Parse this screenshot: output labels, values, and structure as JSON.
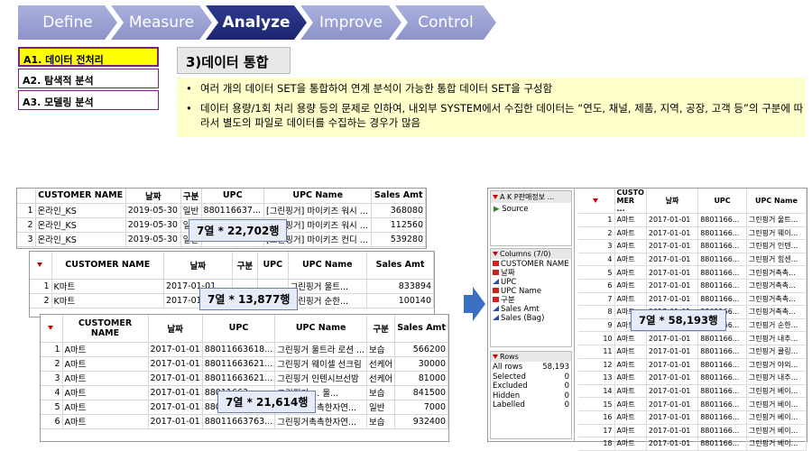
{
  "steps": [
    "Define",
    "Measure",
    "Analyze",
    "Improve",
    "Control"
  ],
  "side_items": [
    "A1. 데이터 전처리",
    "A2. 탐색적 분석",
    "A3. 모델링 분석"
  ],
  "section_title": "3)데이터 통합",
  "bullets": [
    "여러 개의 데이터 SET을 통합하여 연계 분석이 가능한 통합 데이터 SET을 구성함",
    "데이터 용량/1회 처리 용량 등의 문제로 인하여, 내외부 SYSTEM에서 수집한 데이터는 “연도, 채널, 제품, 지역, 공장, 고객 등”의 구분에 따라서 별도의 파일로 데이터를 수집하는 경우가 많음"
  ],
  "table1": {
    "headers": [
      "CUSTOMER NAME",
      "날짜",
      "구분",
      "UPC",
      "UPC Name",
      "Sales Amt"
    ],
    "rows": [
      [
        "1",
        "온라인_KS",
        "2019-05-30",
        "일반",
        "880116637...",
        "[그린핑거] 마이키즈 워시 ...",
        "368080"
      ],
      [
        "2",
        "온라인_KS",
        "2019-05-30",
        "일반",
        "",
        "[그린핑거] 마이키즈 워시 ...",
        "112560"
      ],
      [
        "3",
        "온라인_KS",
        "2019-05-30",
        "일반",
        "880116637...",
        "[그린핑거] 마이키즈 컨디 ...",
        "539280"
      ]
    ],
    "badge": "7열 * 22,702행"
  },
  "table2": {
    "headers": [
      "CUSTOMER NAME",
      "날짜",
      "구분",
      "UPC",
      "UPC Name",
      "Sales Amt"
    ],
    "rows": [
      [
        "1",
        "K마트",
        "2017-01-01",
        "",
        "",
        "그린핑거 울트...",
        "833894"
      ],
      [
        "2",
        "K마트",
        "2017-01-01",
        "",
        "",
        "그린핑거 순한...",
        "100140"
      ]
    ],
    "badge": "7열 * 13,877행"
  },
  "table3": {
    "headers": [
      "CUSTOMER NAME",
      "날짜",
      "UPC",
      "UPC Name",
      "구분",
      "Sales Amt"
    ],
    "rows": [
      [
        "1",
        "A마트",
        "2017-01-01",
        "88011663618...",
        "그린핑거 울트라 로션 ...",
        "보습",
        "566200"
      ],
      [
        "2",
        "A마트",
        "2017-01-01",
        "88011663621...",
        "그린핑거 웨이셀 선크림",
        "선케어",
        "30000"
      ],
      [
        "3",
        "A마트",
        "2017-01-01",
        "88011663621...",
        "그린핑거 인텐시브선밤",
        "선케어",
        "81000"
      ],
      [
        "4",
        "A마트",
        "2017-01-01",
        "88011663...",
        "그린핑거 ... 울...",
        "보습",
        "841500"
      ],
      [
        "5",
        "A마트",
        "2017-01-01",
        "88011663761...",
        "그린핑거촉촉한자연...",
        "일반",
        "7000"
      ],
      [
        "6",
        "A마트",
        "2017-01-01",
        "88011663763...",
        "그린핑거촉촉한자연...",
        "보습",
        "932400"
      ]
    ],
    "badge": "7열 * 21,614행"
  },
  "jmp": {
    "title": "A K P판매정보 ...",
    "source": "Source",
    "columns_label": "Columns (7/0)",
    "columns": [
      "CUSTOMER NAME",
      "날짜",
      "UPC",
      "UPC Name",
      "구분",
      "Sales Amt",
      "Sales (Bag)"
    ],
    "rows_label": "Rows",
    "row_stats": [
      [
        "All rows",
        "58,193"
      ],
      [
        "Selected",
        "0"
      ],
      [
        "Excluded",
        "0"
      ],
      [
        "Hidden",
        "0"
      ],
      [
        "Labelled",
        "0"
      ]
    ],
    "headers": [
      "CUSTO MER ...",
      "날짜",
      "UPC",
      "UPC Name"
    ],
    "rows": [
      [
        "1",
        "A마트",
        "2017-01-01",
        "8801166...",
        "그린핑거 울트..."
      ],
      [
        "2",
        "A마트",
        "2017-01-01",
        "8801166...",
        "그린핑거 웨이..."
      ],
      [
        "3",
        "A마트",
        "2017-01-01",
        "8801166...",
        "그린핑거 인텐..."
      ],
      [
        "4",
        "A마트",
        "2017-01-01",
        "8801166...",
        "그린핑거 힘센..."
      ],
      [
        "5",
        "A마트",
        "2017-01-01",
        "8801166...",
        "그린핑거촉촉..."
      ],
      [
        "6",
        "A마트",
        "2017-01-01",
        "8801166...",
        "그린핑거촉촉..."
      ],
      [
        "7",
        "A마트",
        "2017-01-01",
        "8801166...",
        "그린핑거촉촉..."
      ],
      [
        "8",
        "A마트",
        "2017-01-01",
        "8801166...",
        "그린핑거촉촉..."
      ],
      [
        "9",
        "A마트",
        "2017-01-01",
        "8801166...",
        "그린핑거 순한..."
      ],
      [
        "10",
        "A마트",
        "2017-01-01",
        "8801166...",
        "그린핑거 내추..."
      ],
      [
        "11",
        "A마트",
        "2017-01-01",
        "8801166...",
        "그린핑거 쿨링..."
      ],
      [
        "12",
        "A마트",
        "2017-01-01",
        "8801166...",
        "그린핑거 야외..."
      ],
      [
        "13",
        "A마트",
        "2017-01-01",
        "8801166...",
        "그린핑거 내추..."
      ],
      [
        "14",
        "A마트",
        "2017-01-01",
        "8801166...",
        "그린핑거 베이..."
      ],
      [
        "15",
        "A마트",
        "2017-01-01",
        "8801166...",
        "그린핑거 베이..."
      ],
      [
        "16",
        "A마트",
        "2017-01-01",
        "8801166...",
        "그린핑거 베이..."
      ],
      [
        "17",
        "A마트",
        "2017-01-01",
        "8801166...",
        "그린핑거 베이..."
      ],
      [
        "18",
        "A마트",
        "2017-01-01",
        "8801166...",
        "그린핑거 베이..."
      ]
    ],
    "badge": "7열 * 58,193행"
  }
}
